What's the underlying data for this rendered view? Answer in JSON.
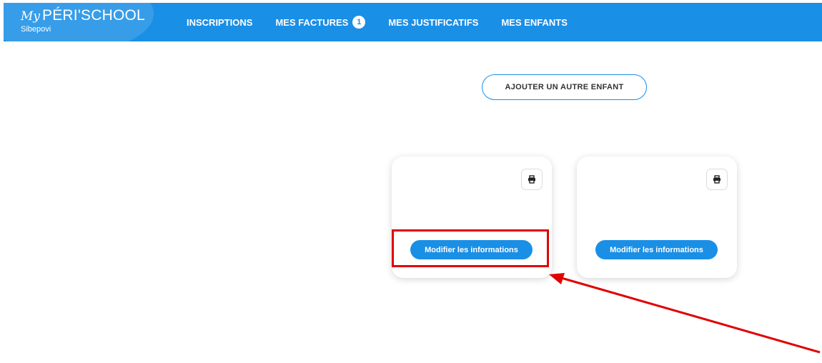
{
  "brand": {
    "my": "My",
    "name": "PÉRI'SCHOOL",
    "subtitle": "Sibepovi"
  },
  "nav": {
    "items": [
      {
        "label": "INSCRIPTIONS"
      },
      {
        "label": "MES FACTURES",
        "badge": "1"
      },
      {
        "label": "MES JUSTIFICATIFS"
      },
      {
        "label": "MES ENFANTS"
      }
    ]
  },
  "main": {
    "add_child_label": "AJOUTER UN AUTRE ENFANT",
    "cards": [
      {
        "edit_label": "Modifier les informations",
        "print_icon": "print-icon"
      },
      {
        "edit_label": "Modifier les informations",
        "print_icon": "print-icon"
      }
    ]
  },
  "annotation": {
    "color": "#e00000"
  },
  "colors": {
    "accent": "#1a8fe6"
  }
}
